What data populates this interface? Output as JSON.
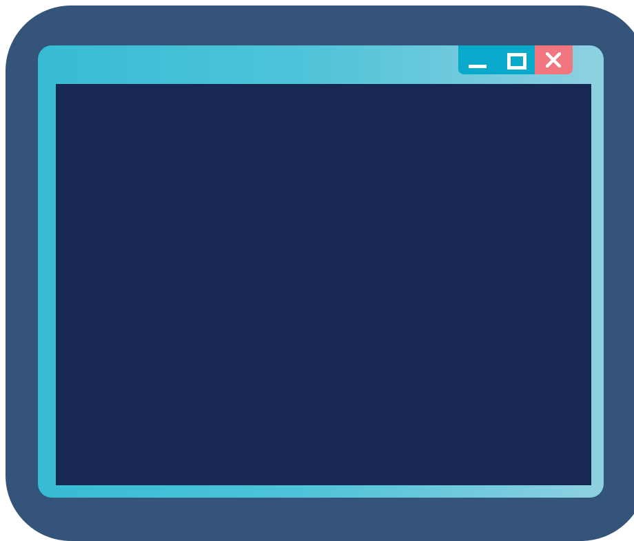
{
  "window": {
    "controls": {
      "minimize_icon": "minimize-icon",
      "maximize_icon": "maximize-icon",
      "close_icon": "close-icon"
    }
  },
  "colors": {
    "backdrop": "#345479",
    "frame_start": "#37bcd3",
    "frame_end": "#8ed1e2",
    "content": "#172953",
    "control_button": "#09a9cc",
    "close_button": "#f1767f",
    "glyph": "#ffffff"
  }
}
